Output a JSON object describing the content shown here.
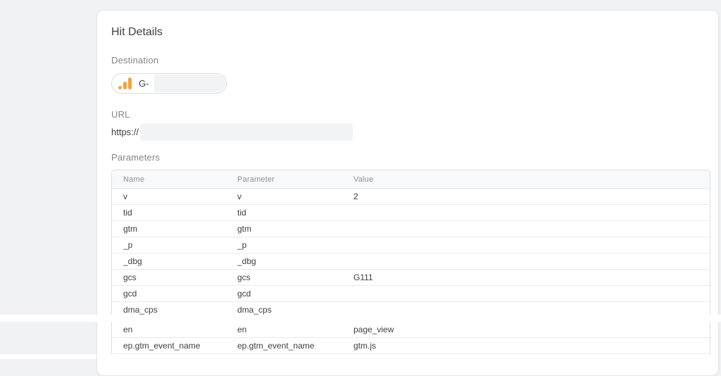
{
  "card": {
    "title": "Hit Details",
    "destination": {
      "label": "Destination",
      "tag_prefix": "G-",
      "icon": "google-analytics-icon"
    },
    "url": {
      "label": "URL",
      "value_prefix": "https://"
    },
    "parameters": {
      "label": "Parameters",
      "columns": [
        "Name",
        "Parameter",
        "Value"
      ],
      "rows": [
        {
          "name": "v",
          "parameter": "v",
          "value": "2"
        },
        {
          "name": "tid",
          "parameter": "tid",
          "value": ""
        },
        {
          "name": "gtm",
          "parameter": "gtm",
          "value": ""
        },
        {
          "name": "_p",
          "parameter": "_p",
          "value": ""
        },
        {
          "name": "_dbg",
          "parameter": "_dbg",
          "value": ""
        },
        {
          "name": "gcs",
          "parameter": "gcs",
          "value": "G111"
        },
        {
          "name": "gcd",
          "parameter": "gcd",
          "value": ""
        },
        {
          "name": "dma_cps",
          "parameter": "dma_cps",
          "value": ""
        }
      ],
      "rows_after_gap": [
        {
          "name": "en",
          "parameter": "en",
          "value": "page_view"
        },
        {
          "name": "ep.gtm_event_name",
          "parameter": "ep.gtm_event_name",
          "value": "gtm.js"
        }
      ]
    }
  },
  "colors": {
    "accent_orange": "#f2a33b",
    "background_gray": "#f1f2f4",
    "redaction_gray": "#f1f3f4",
    "text_primary": "#3c4043",
    "text_secondary": "#80868b"
  }
}
